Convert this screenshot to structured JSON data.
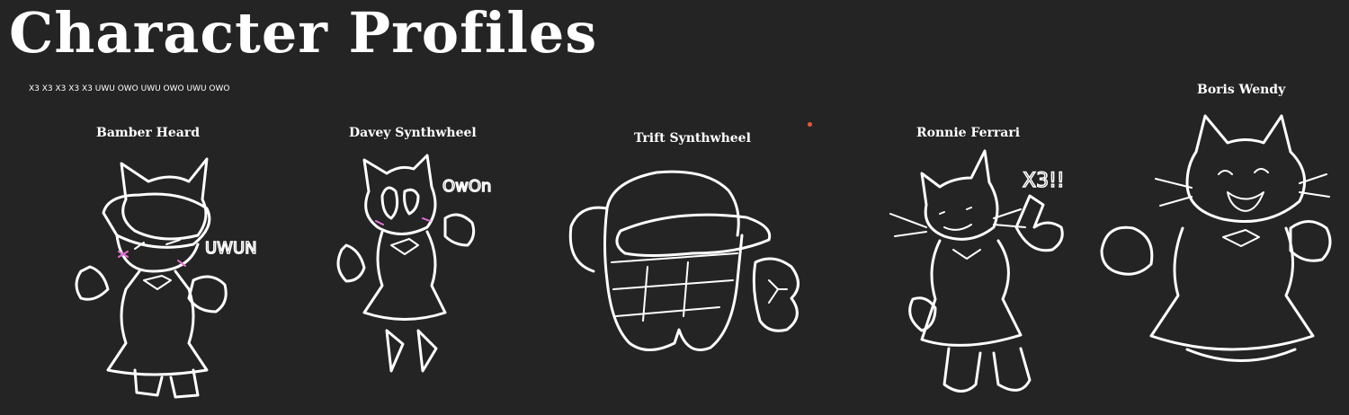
{
  "page": {
    "title": "Character Profiles",
    "subtitle": "X3 X3 X3 X3 X3 UWU OWO UWU OWO UWU OWO"
  },
  "profiles": [
    {
      "name": "Bamber Heard",
      "caption": "UWUN"
    },
    {
      "name": "Davey Synthwheel",
      "caption": "OwOn"
    },
    {
      "name": "Trift Synthwheel",
      "caption": ""
    },
    {
      "name": "Ronnie Ferrari",
      "caption": "X3!!"
    },
    {
      "name": "Boris Wendy",
      "caption": ""
    }
  ],
  "colors": {
    "background": "#242424",
    "line_art": "#ffffff",
    "blush": "#e66fd6",
    "dot": "#e8583a"
  }
}
